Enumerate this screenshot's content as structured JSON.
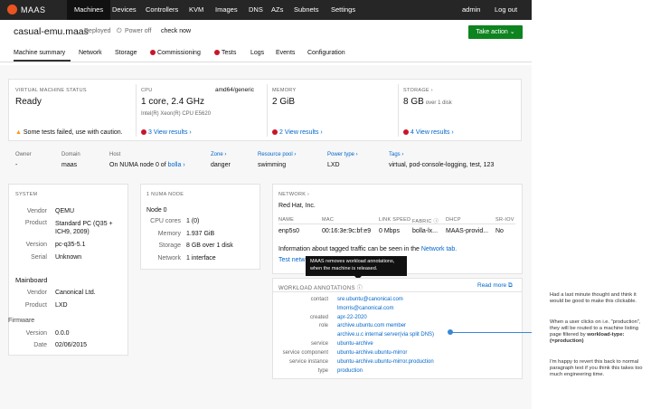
{
  "nav": {
    "logo_text": "MAAS",
    "items": [
      "Machines",
      "Devices",
      "Controllers",
      "KVM",
      "Images",
      "DNS",
      "AZs",
      "Subnets",
      "Settings"
    ],
    "user": "admin",
    "logout": "Log out"
  },
  "header": {
    "title": "casual-emu.maas",
    "status": "Deployed",
    "power": "Power off",
    "check": "check now",
    "take_action": "Take action"
  },
  "tabs": [
    "Machine summary",
    "Network",
    "Storage",
    "Commissioning",
    "Tests",
    "Logs",
    "Events",
    "Configuration"
  ],
  "summary": {
    "vm_label": "VIRTUAL MACHINE STATUS",
    "vm_value": "Ready",
    "vm_warning": "Some tests failed, use with caution.",
    "cpu_label": "CPU",
    "cpu_arch": "amd64/generic",
    "cpu_value": "1 core, 2.4 GHz",
    "cpu_model": "Intel(R) Xeon(R) CPU E5620",
    "cpu_results": "3 View results ›",
    "mem_label": "MEMORY",
    "mem_value": "2 GiB",
    "mem_results": "2 View results ›",
    "storage_label": "STORAGE ›",
    "storage_value": "8 GB",
    "storage_over": "over 1 disk",
    "storage_results": "4 View results ›"
  },
  "owner_row": {
    "headers": [
      "Owner",
      "Domain",
      "Host",
      "Zone ›",
      "Resource pool ›",
      "Power type ›",
      "Tags ›"
    ],
    "values": [
      "-",
      "maas",
      "On NUMA node 0 of ",
      "danger",
      "swimming",
      "LXD",
      "virtual, pod-console-logging, test, 123"
    ],
    "host_link": "bolla ›"
  },
  "system": {
    "label": "SYSTEM",
    "rows": [
      {
        "k": "Vendor",
        "v": "QEMU"
      },
      {
        "k": "Product",
        "v": "Standard PC (Q35 + ICH9, 2009)"
      },
      {
        "k": "Version",
        "v": "pc-q35-5.1"
      },
      {
        "k": "Serial",
        "v": "Unknown"
      }
    ],
    "mainboard": "Mainboard",
    "mb_rows": [
      {
        "k": "Vendor",
        "v": "Canonical Ltd."
      },
      {
        "k": "Product",
        "v": "LXD"
      }
    ],
    "firmware": "Firmware",
    "fw_rows": [
      {
        "k": "Version",
        "v": "0.0.0"
      },
      {
        "k": "Date",
        "v": "02/06/2015"
      }
    ]
  },
  "numa": {
    "label": "1 NUMA NODE",
    "node": "Node 0",
    "rows": [
      {
        "k": "CPU cores",
        "v": "1 (0)"
      },
      {
        "k": "Memory",
        "v": "1.937 GiB"
      },
      {
        "k": "Storage",
        "v": "8 GB over 1 disk"
      },
      {
        "k": "Network",
        "v": "1 interface"
      }
    ]
  },
  "network": {
    "label": "NETWORK ›",
    "vendor": "Red Hat, Inc.",
    "headers": [
      "NAME",
      "MAC",
      "LINK SPEED",
      "FABRIC",
      "DHCP",
      "SR-IOV"
    ],
    "row": [
      "enp5s0",
      "00:16:3e:9c:bf:e9",
      "0 Mbps",
      "bolla-lx...",
      "MAAS-provid...",
      "No"
    ],
    "info": "Information about tagged traffic can be seen in the ",
    "info_link": "Network tab.",
    "test_link": "Test netw"
  },
  "tooltip": "MAAS removes workload annotations, when the machine is released.",
  "workload": {
    "label": "WORKLOAD ANNOTATIONS",
    "read_more": "Read more",
    "rows": [
      {
        "k": "contact",
        "v": "sre.ubuntu@canonical.com"
      },
      {
        "k": "",
        "v": "lmorris@canonical.com"
      },
      {
        "k": "created",
        "v": "apr-22-2020"
      },
      {
        "k": "role",
        "v": "archive.ubuntu.com member"
      },
      {
        "k": "",
        "v": "archive.u.c internal server(via split DNS)"
      },
      {
        "k": "service",
        "v": "ubuntu-archive"
      },
      {
        "k": "service component",
        "v": "ubuntu-archive.ubuntu-mirror"
      },
      {
        "k": "service instance",
        "v": "ubuntu-archive.ubuntu-mirror.production"
      },
      {
        "k": "type",
        "v": "production"
      }
    ]
  },
  "notes": {
    "p1": "Had a last minute thought and think it would be good to make this clickable.",
    "p2a": "When a user clicks on i.e. \"production\", they will be routed to a machine listing page filtered by",
    "p2b": "workload-type:(=production)",
    "p3": "I'm happy to revert this back to normal paragraph text if you think this takes too much engineering time."
  }
}
